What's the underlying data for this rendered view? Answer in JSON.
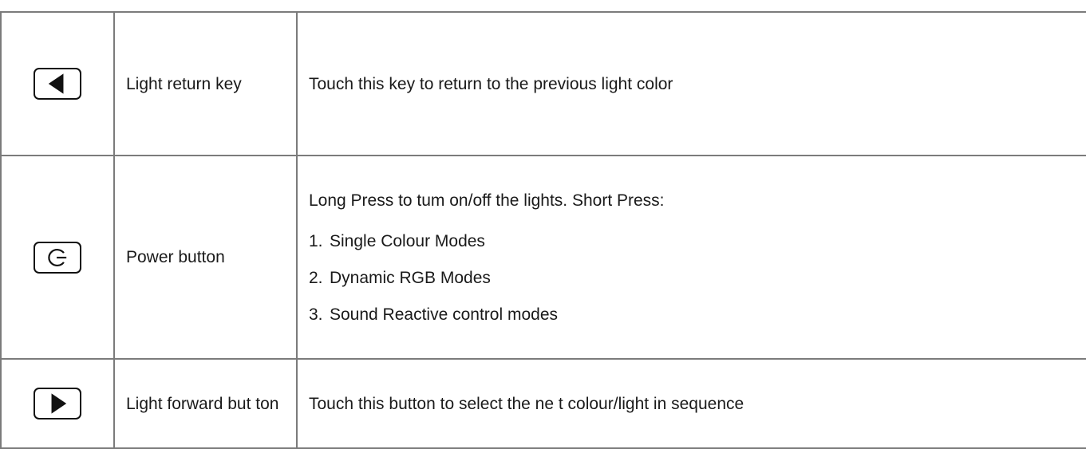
{
  "rows": [
    {
      "icon": "left-triangle-icon",
      "name": "Light return key",
      "description": "Touch this key to return to the previous light color"
    },
    {
      "icon": "power-icon",
      "name": "Power button",
      "description_intro": "Long Press to tum on/off the lights. Short Press:",
      "modes": [
        {
          "num": "1.",
          "label": "Single Colour Modes"
        },
        {
          "num": "2.",
          "label": "Dynamic RGB Modes"
        },
        {
          "num": "3.",
          "label": "Sound Reactive control modes"
        }
      ]
    },
    {
      "icon": "right-triangle-icon",
      "name": "Light forward but ton",
      "description": "Touch this button to select the ne t colour/light in sequence"
    }
  ]
}
